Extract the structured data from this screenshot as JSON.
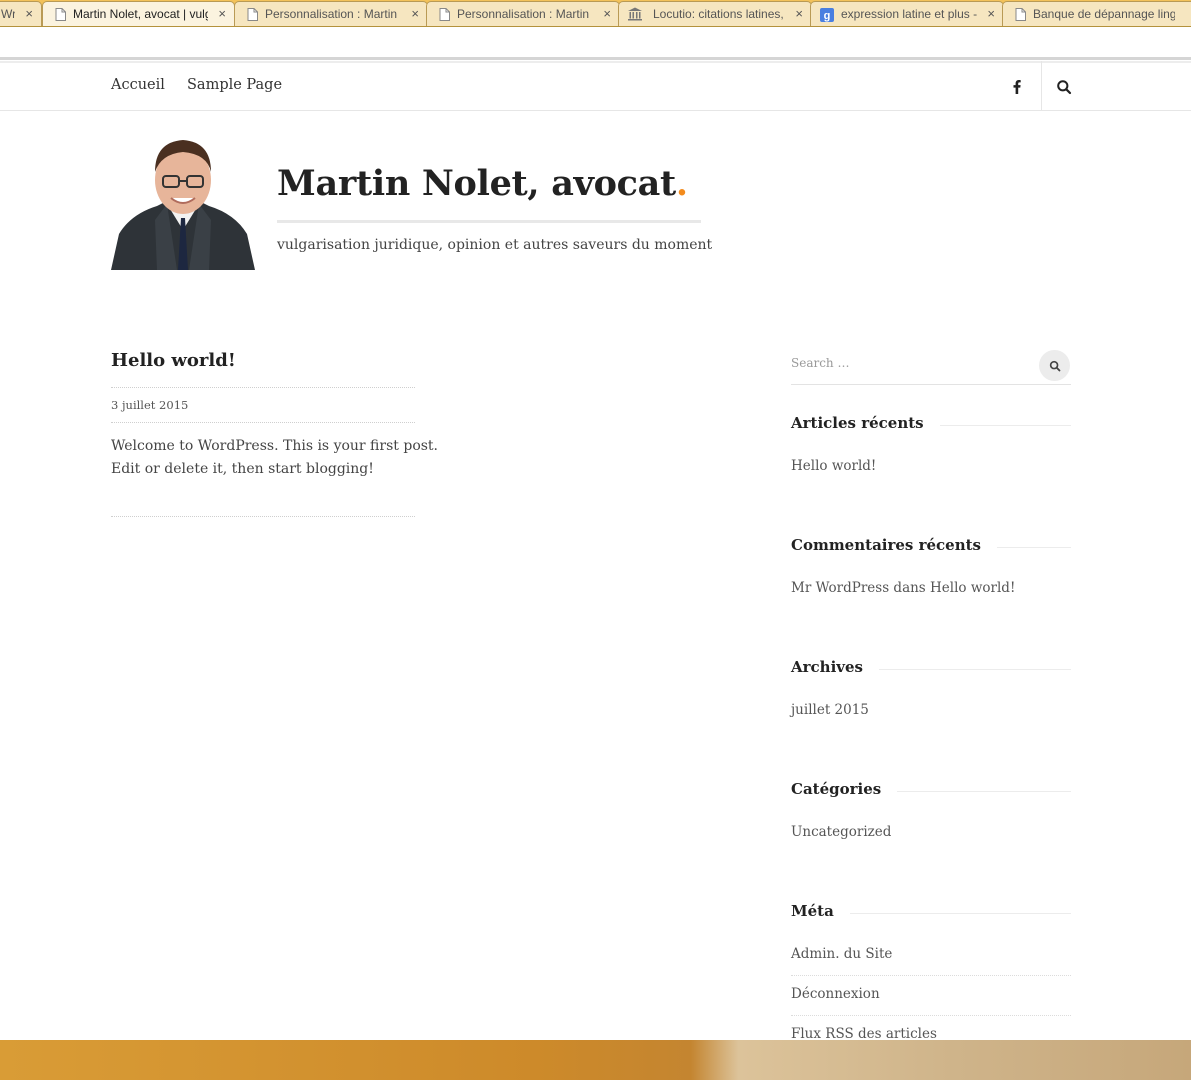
{
  "browser": {
    "tabs": [
      {
        "title": "Writ",
        "icon": "page-icon"
      },
      {
        "title": "Martin Nolet, avocat | vulgarisation juridique",
        "icon": "page-icon",
        "active": true
      },
      {
        "title": "Personnalisation : Martin Nolet",
        "icon": "page-icon"
      },
      {
        "title": "Personnalisation : Martin Nolet",
        "icon": "page-icon"
      },
      {
        "title": "Locutio: citations latines, expressions",
        "icon": "temple-icon"
      },
      {
        "title": "expression latine et plus - Recherche",
        "icon": "google-icon"
      },
      {
        "title": "Banque de dépannage linguistique",
        "icon": "page-icon"
      }
    ],
    "close_glyph": "×"
  },
  "nav": {
    "items": [
      "Accueil",
      "Sample Page"
    ]
  },
  "header": {
    "site_title": "Martin Nolet, avocat",
    "title_dot": ".",
    "tagline": "vulgarisation juridique, opinion et autres saveurs du moment"
  },
  "post": {
    "title": "Hello world!",
    "date": "3 juillet 2015",
    "excerpt_line1": "Welcome to WordPress. This is your first post.",
    "excerpt_line2": "Edit or delete it, then start blogging!"
  },
  "sidebar": {
    "search_placeholder": "Search …",
    "widgets": {
      "recent_posts": {
        "title": "Articles récents",
        "items": [
          "Hello world!"
        ]
      },
      "recent_comments": {
        "title": "Commentaires récents",
        "items": [
          "Mr WordPress dans Hello world!"
        ]
      },
      "archives": {
        "title": "Archives",
        "items": [
          "juillet 2015"
        ]
      },
      "categories": {
        "title": "Catégories",
        "items": [
          "Uncategorized"
        ]
      },
      "meta": {
        "title": "Méta",
        "items": [
          "Admin. du Site",
          "Déconnexion",
          "Flux RSS des articles"
        ]
      }
    }
  },
  "colors": {
    "accent_dot": "#f38b1c",
    "tab_strip": "#f3c25a",
    "text_dark": "#222222"
  }
}
